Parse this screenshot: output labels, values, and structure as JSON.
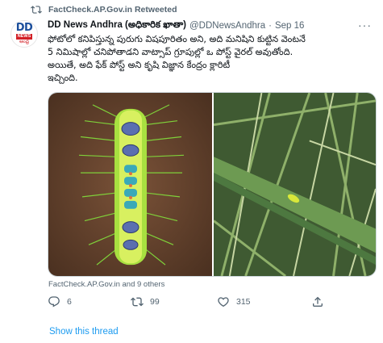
{
  "retweet": {
    "label": "FactCheck.AP.Gov.in Retweeted",
    "icon": "retweet-icon"
  },
  "author": {
    "name": "DD News Andhra (అధికారిక ఖాతా)",
    "handle": "@DDNewsAndhra",
    "time": "Sep 16",
    "avatar_logo": "DD",
    "avatar_banner": "NEWS",
    "avatar_script": "ఆంధ్ర"
  },
  "tweet": {
    "lines": [
      "ఫోటోలో కనిపిస్తున్న పురుగు విషపూరితం అని, అది మనిషిని కుట్టిన వెంటనే",
      "5 నిమిషాల్లో చనిపోతాడని వాట్సాప్ గ్రూపుల్లో ఒ పోస్ట్ వైరల్ అవుతోంది.",
      "అయితే, అది ఫేక్ పోస్ట్ అని కృషి విజ్ఞాన కేంద్రం క్లారిటీ",
      "ఇచ్చింది."
    ]
  },
  "media": {
    "tagged": "FactCheck.AP.Gov.in and 9 others"
  },
  "actions": {
    "replies": "6",
    "retweets": "99",
    "likes": "315"
  },
  "show_thread": "Show this thread",
  "colors": {
    "link": "#1d9bf0",
    "muted": "#536471",
    "text": "#0f1419"
  }
}
